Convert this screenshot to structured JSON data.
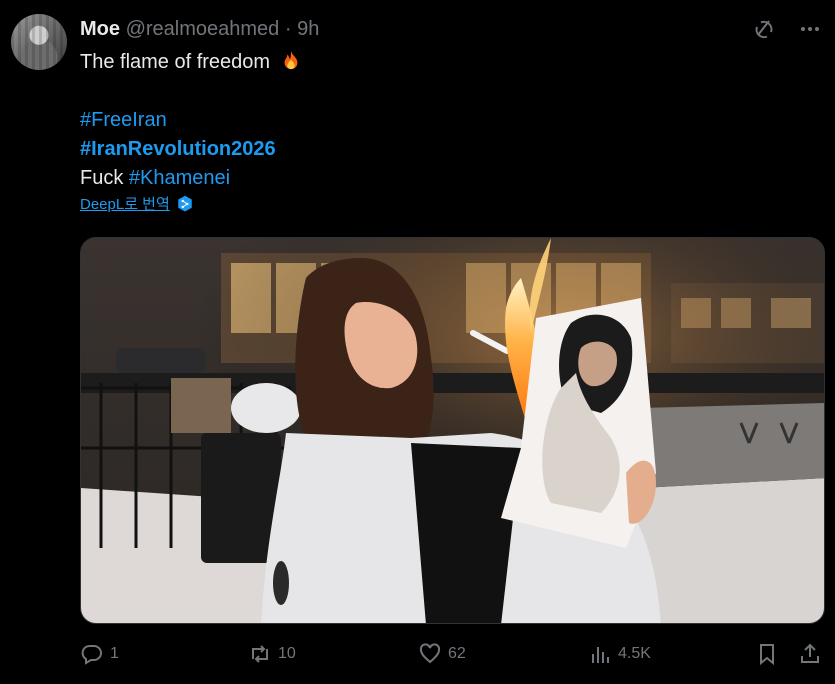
{
  "post": {
    "author_name": "Moe",
    "handle": "@realmoeahmed",
    "separator": "·",
    "time": "9h",
    "line1": "The flame of freedom",
    "tag1": "#FreeIran",
    "tag2": "#IranRevolution2026",
    "line4_prefix": "Fuck ",
    "tag3": "#Khamenei",
    "translate_label": "DeepL로 번역"
  },
  "actions": {
    "reply_count": "1",
    "repost_count": "10",
    "like_count": "62",
    "views_count": "4.5K"
  },
  "icons": [
    "grok-icon",
    "more-icon",
    "fire-emoji-icon",
    "deepl-icon",
    "reply-icon",
    "repost-icon",
    "like-icon",
    "views-icon",
    "bookmark-icon",
    "share-icon"
  ],
  "colors": {
    "background": "#000000",
    "text": "#e7e9ea",
    "muted": "#71767b",
    "link": "#1d9bf0"
  }
}
